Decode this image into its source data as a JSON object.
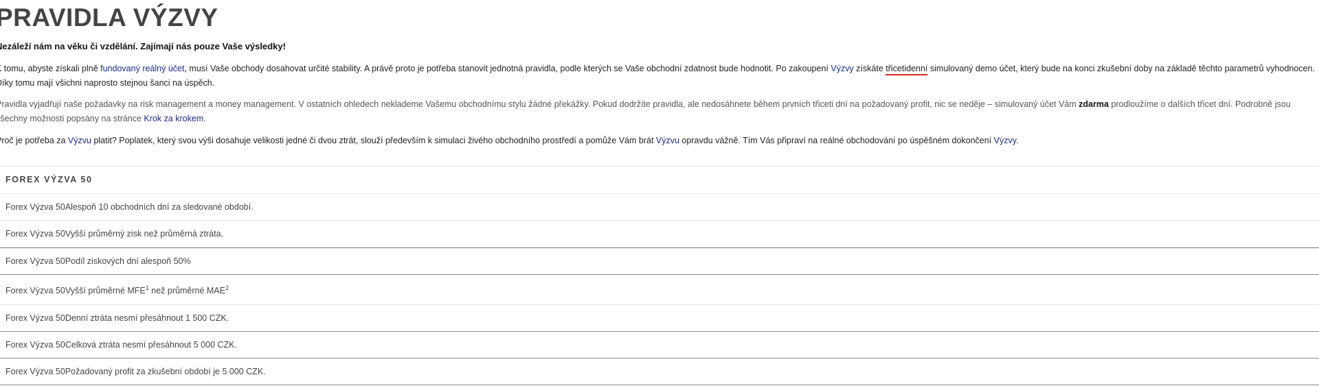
{
  "heading": "PRAVIDLA VÝZVY",
  "intro_bold": "Nezáleží nám na věku či vzdělání. Zajímají nás pouze Vaše výsledky!",
  "p1": {
    "t1": "K tomu, abyste získali plně ",
    "link_funded": "fundovaný reálný účet",
    "t2": ", musí Vaše obchody dosahovat určité stability. A právě proto je potřeba stanovit jednotná pravidla, podle kterých se Vaše obchodní zdatnost bude hodnotit. Po zakoupení ",
    "link_vyzvy": "Výzvy",
    "t3": " získáte ",
    "underlined": "třicetidenní",
    "t4": " simulovaný demo účet, který bude na konci zkušební doby na základě těchto parametrů vyhodnocen. Díky tomu mají všichni naprosto stejnou šanci na úspěch."
  },
  "p2": {
    "t1": "Pravidla vyjadřují naše požadavky na risk management a money management. V ostatních ohledech neklademe Vašemu obchodnímu stylu žádné překážky. Pokud dodržíte pravidla, ale nedosáhnete během prvních třiceti dní na požadovaný profit, nic se neděje – simulovaný účet Vám ",
    "bold": "zdarma",
    "t2": " prodloužíme o dalších třicet dní. Podrobně jsou všechny možnosti popsány na stránce ",
    "link": "Krok za krokem",
    "t3": "."
  },
  "p3": {
    "t1": "Proč je potřeba za ",
    "link1": "Výzvu",
    "t2": " platit? Poplatek, který svou výši dosahuje velikosti jedné či dvou ztrát, slouží především k simulaci živého obchodního prostředí a pomůže Vám brát ",
    "link2": "Výzvu",
    "t3": " opravdu vážně. Tím Vás připraví na reálné obchodování po úspěšném dokončení ",
    "link3": "Výzvy",
    "t4": "."
  },
  "table": {
    "header": "FOREX VÝZVA 50",
    "rows": [
      "Forex Výzva 50Alespoň 10 obchodních dní za sledované období.",
      "Forex Výzva 50Vyšší průměrný zisk než průměrná ztráta.",
      "Forex Výzva 50Podíl ziskových dní alespoň 50%",
      "",
      "Forex Výzva 50Denní ztráta nesmí přesáhnout 1 500 CZK.",
      "Forex Výzva 50Celková ztráta nesmí přesáhnout 5 000 CZK.",
      "Forex Výzva 50Požadovaný profit za zkušební období je 5 000 CZK."
    ],
    "row4": {
      "t1": "Forex Výzva 50Vyšší průměrné MFE",
      "sup1": "1",
      "t2": " než průměrné MAE",
      "sup2": "2"
    }
  }
}
